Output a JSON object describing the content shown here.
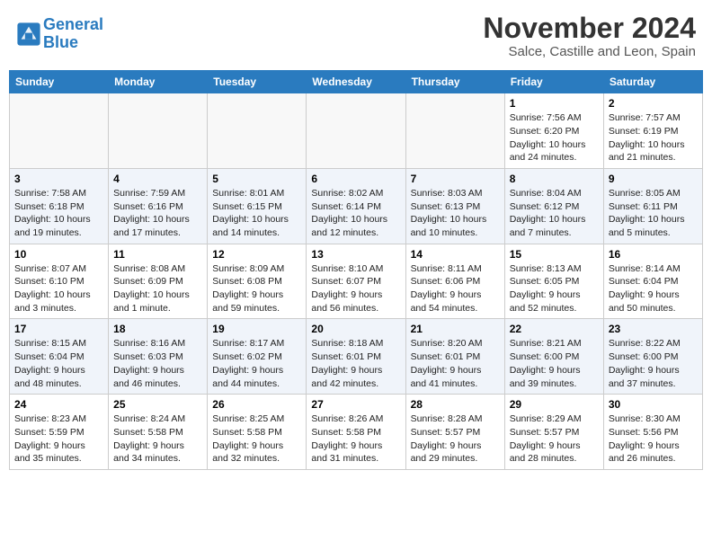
{
  "header": {
    "logo_line1": "General",
    "logo_line2": "Blue",
    "month": "November 2024",
    "location": "Salce, Castille and Leon, Spain"
  },
  "weekdays": [
    "Sunday",
    "Monday",
    "Tuesday",
    "Wednesday",
    "Thursday",
    "Friday",
    "Saturday"
  ],
  "weeks": [
    [
      {
        "day": "",
        "info": ""
      },
      {
        "day": "",
        "info": ""
      },
      {
        "day": "",
        "info": ""
      },
      {
        "day": "",
        "info": ""
      },
      {
        "day": "",
        "info": ""
      },
      {
        "day": "1",
        "info": "Sunrise: 7:56 AM\nSunset: 6:20 PM\nDaylight: 10 hours and 24 minutes."
      },
      {
        "day": "2",
        "info": "Sunrise: 7:57 AM\nSunset: 6:19 PM\nDaylight: 10 hours and 21 minutes."
      }
    ],
    [
      {
        "day": "3",
        "info": "Sunrise: 7:58 AM\nSunset: 6:18 PM\nDaylight: 10 hours and 19 minutes."
      },
      {
        "day": "4",
        "info": "Sunrise: 7:59 AM\nSunset: 6:16 PM\nDaylight: 10 hours and 17 minutes."
      },
      {
        "day": "5",
        "info": "Sunrise: 8:01 AM\nSunset: 6:15 PM\nDaylight: 10 hours and 14 minutes."
      },
      {
        "day": "6",
        "info": "Sunrise: 8:02 AM\nSunset: 6:14 PM\nDaylight: 10 hours and 12 minutes."
      },
      {
        "day": "7",
        "info": "Sunrise: 8:03 AM\nSunset: 6:13 PM\nDaylight: 10 hours and 10 minutes."
      },
      {
        "day": "8",
        "info": "Sunrise: 8:04 AM\nSunset: 6:12 PM\nDaylight: 10 hours and 7 minutes."
      },
      {
        "day": "9",
        "info": "Sunrise: 8:05 AM\nSunset: 6:11 PM\nDaylight: 10 hours and 5 minutes."
      }
    ],
    [
      {
        "day": "10",
        "info": "Sunrise: 8:07 AM\nSunset: 6:10 PM\nDaylight: 10 hours and 3 minutes."
      },
      {
        "day": "11",
        "info": "Sunrise: 8:08 AM\nSunset: 6:09 PM\nDaylight: 10 hours and 1 minute."
      },
      {
        "day": "12",
        "info": "Sunrise: 8:09 AM\nSunset: 6:08 PM\nDaylight: 9 hours and 59 minutes."
      },
      {
        "day": "13",
        "info": "Sunrise: 8:10 AM\nSunset: 6:07 PM\nDaylight: 9 hours and 56 minutes."
      },
      {
        "day": "14",
        "info": "Sunrise: 8:11 AM\nSunset: 6:06 PM\nDaylight: 9 hours and 54 minutes."
      },
      {
        "day": "15",
        "info": "Sunrise: 8:13 AM\nSunset: 6:05 PM\nDaylight: 9 hours and 52 minutes."
      },
      {
        "day": "16",
        "info": "Sunrise: 8:14 AM\nSunset: 6:04 PM\nDaylight: 9 hours and 50 minutes."
      }
    ],
    [
      {
        "day": "17",
        "info": "Sunrise: 8:15 AM\nSunset: 6:04 PM\nDaylight: 9 hours and 48 minutes."
      },
      {
        "day": "18",
        "info": "Sunrise: 8:16 AM\nSunset: 6:03 PM\nDaylight: 9 hours and 46 minutes."
      },
      {
        "day": "19",
        "info": "Sunrise: 8:17 AM\nSunset: 6:02 PM\nDaylight: 9 hours and 44 minutes."
      },
      {
        "day": "20",
        "info": "Sunrise: 8:18 AM\nSunset: 6:01 PM\nDaylight: 9 hours and 42 minutes."
      },
      {
        "day": "21",
        "info": "Sunrise: 8:20 AM\nSunset: 6:01 PM\nDaylight: 9 hours and 41 minutes."
      },
      {
        "day": "22",
        "info": "Sunrise: 8:21 AM\nSunset: 6:00 PM\nDaylight: 9 hours and 39 minutes."
      },
      {
        "day": "23",
        "info": "Sunrise: 8:22 AM\nSunset: 6:00 PM\nDaylight: 9 hours and 37 minutes."
      }
    ],
    [
      {
        "day": "24",
        "info": "Sunrise: 8:23 AM\nSunset: 5:59 PM\nDaylight: 9 hours and 35 minutes."
      },
      {
        "day": "25",
        "info": "Sunrise: 8:24 AM\nSunset: 5:58 PM\nDaylight: 9 hours and 34 minutes."
      },
      {
        "day": "26",
        "info": "Sunrise: 8:25 AM\nSunset: 5:58 PM\nDaylight: 9 hours and 32 minutes."
      },
      {
        "day": "27",
        "info": "Sunrise: 8:26 AM\nSunset: 5:58 PM\nDaylight: 9 hours and 31 minutes."
      },
      {
        "day": "28",
        "info": "Sunrise: 8:28 AM\nSunset: 5:57 PM\nDaylight: 9 hours and 29 minutes."
      },
      {
        "day": "29",
        "info": "Sunrise: 8:29 AM\nSunset: 5:57 PM\nDaylight: 9 hours and 28 minutes."
      },
      {
        "day": "30",
        "info": "Sunrise: 8:30 AM\nSunset: 5:56 PM\nDaylight: 9 hours and 26 minutes."
      }
    ]
  ]
}
